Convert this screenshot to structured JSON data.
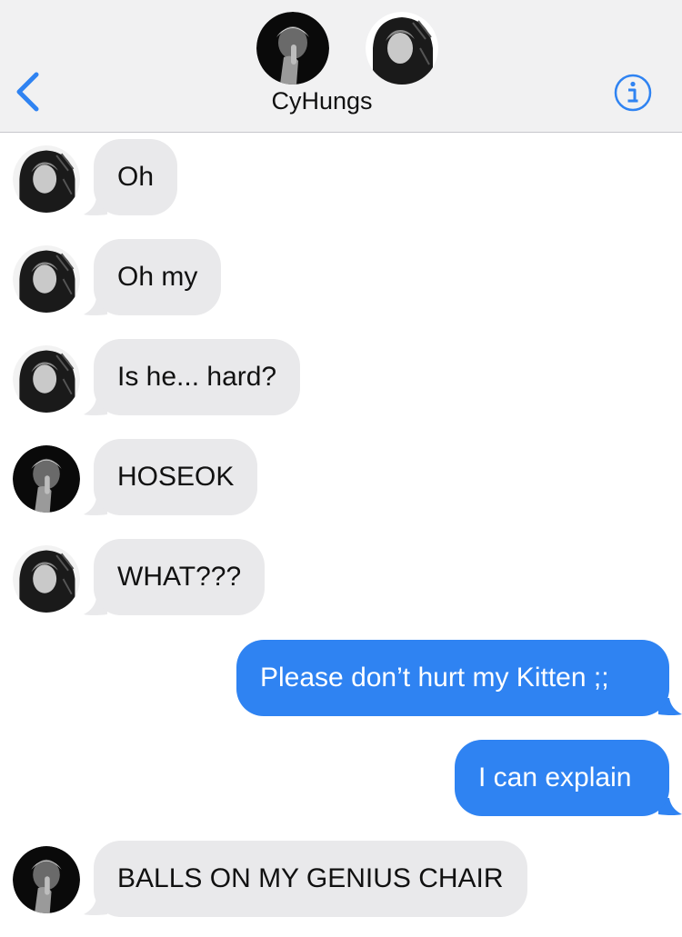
{
  "header": {
    "title": "CyHungs",
    "back_icon": "chevron-left-icon",
    "info_icon": "info-icon",
    "accent_color": "#2f83f2",
    "avatars": [
      "group-member-1-avatar",
      "group-member-2-avatar"
    ]
  },
  "messages": [
    {
      "direction": "incoming",
      "sender_avatar": "member-2-avatar",
      "text": "Oh"
    },
    {
      "direction": "incoming",
      "sender_avatar": "member-2-avatar",
      "text": "Oh my"
    },
    {
      "direction": "incoming",
      "sender_avatar": "member-2-avatar",
      "text": "Is he... hard?"
    },
    {
      "direction": "incoming",
      "sender_avatar": "member-1-avatar",
      "text": "HOSEOK"
    },
    {
      "direction": "incoming",
      "sender_avatar": "member-2-avatar",
      "text": "WHAT???"
    },
    {
      "direction": "outgoing",
      "text": "Please don’t hurt my Kitten ;;"
    },
    {
      "direction": "outgoing",
      "text": "I can explain"
    },
    {
      "direction": "incoming",
      "sender_avatar": "member-1-avatar",
      "text": "BALLS ON MY GENIUS CHAIR"
    }
  ],
  "colors": {
    "incoming_bubble": "#e9e9eb",
    "outgoing_bubble": "#2f83f2",
    "header_background": "#f1f1f2"
  }
}
